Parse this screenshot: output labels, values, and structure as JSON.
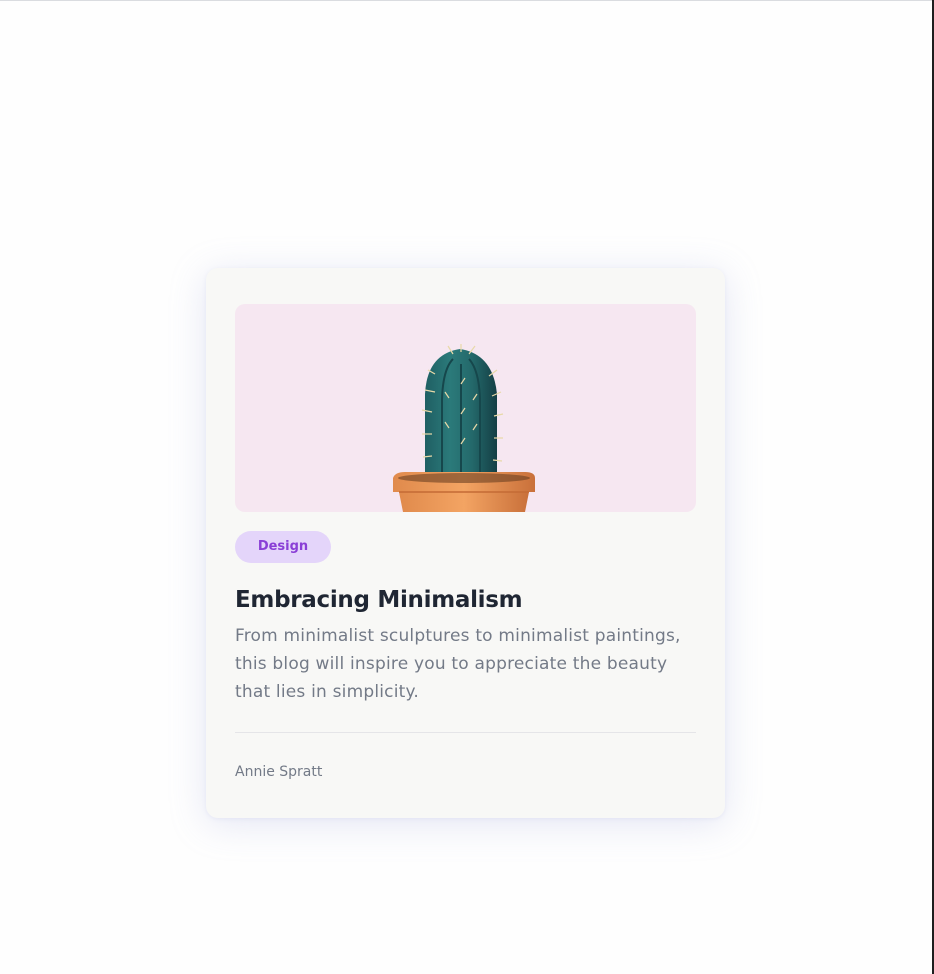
{
  "card": {
    "image": {
      "subject": "cactus-in-orange-pot",
      "background_color": "#f6e7f1"
    },
    "tag": {
      "label": "Design",
      "background_color": "#e4d5fa",
      "text_color": "#8a3fd6"
    },
    "title": "Embracing Minimalism",
    "description": "From minimalist sculptures to minimalist paintings, this blog will inspire you to appreciate the beauty that lies in simplicity.",
    "author": "Annie Spratt"
  }
}
